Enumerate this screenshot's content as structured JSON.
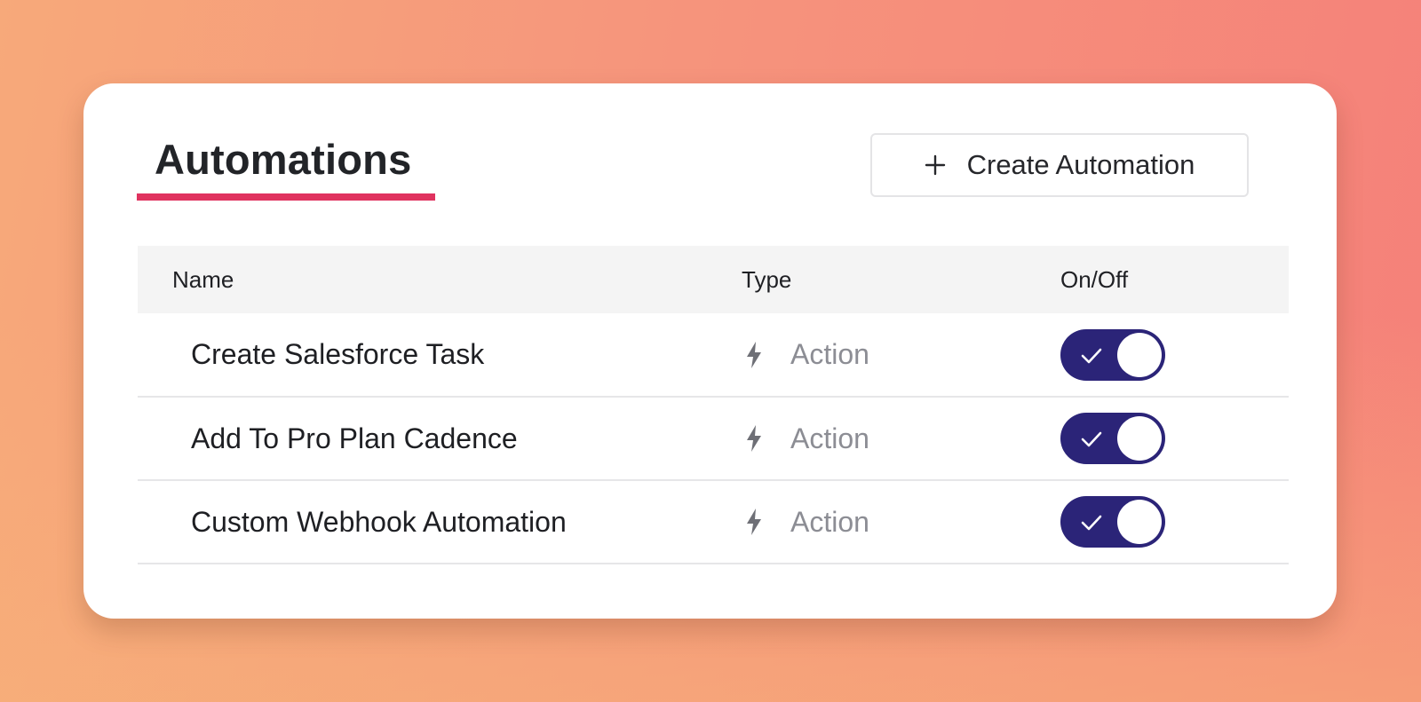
{
  "header": {
    "title": "Automations",
    "create_button_label": "Create Automation",
    "accent_color": "#e0335f"
  },
  "table": {
    "columns": [
      "Name",
      "Type",
      "On/Off"
    ],
    "rows": [
      {
        "name": "Create Salesforce Task",
        "type": "Action",
        "type_icon": "bolt-icon",
        "enabled": true
      },
      {
        "name": "Add To Pro Plan Cadence",
        "type": "Action",
        "type_icon": "bolt-icon",
        "enabled": true
      },
      {
        "name": "Custom Webhook Automation",
        "type": "Action",
        "type_icon": "bolt-icon",
        "enabled": true
      }
    ]
  },
  "colors": {
    "toggle_on": "#2b2478",
    "type_text": "#8c8d94"
  }
}
